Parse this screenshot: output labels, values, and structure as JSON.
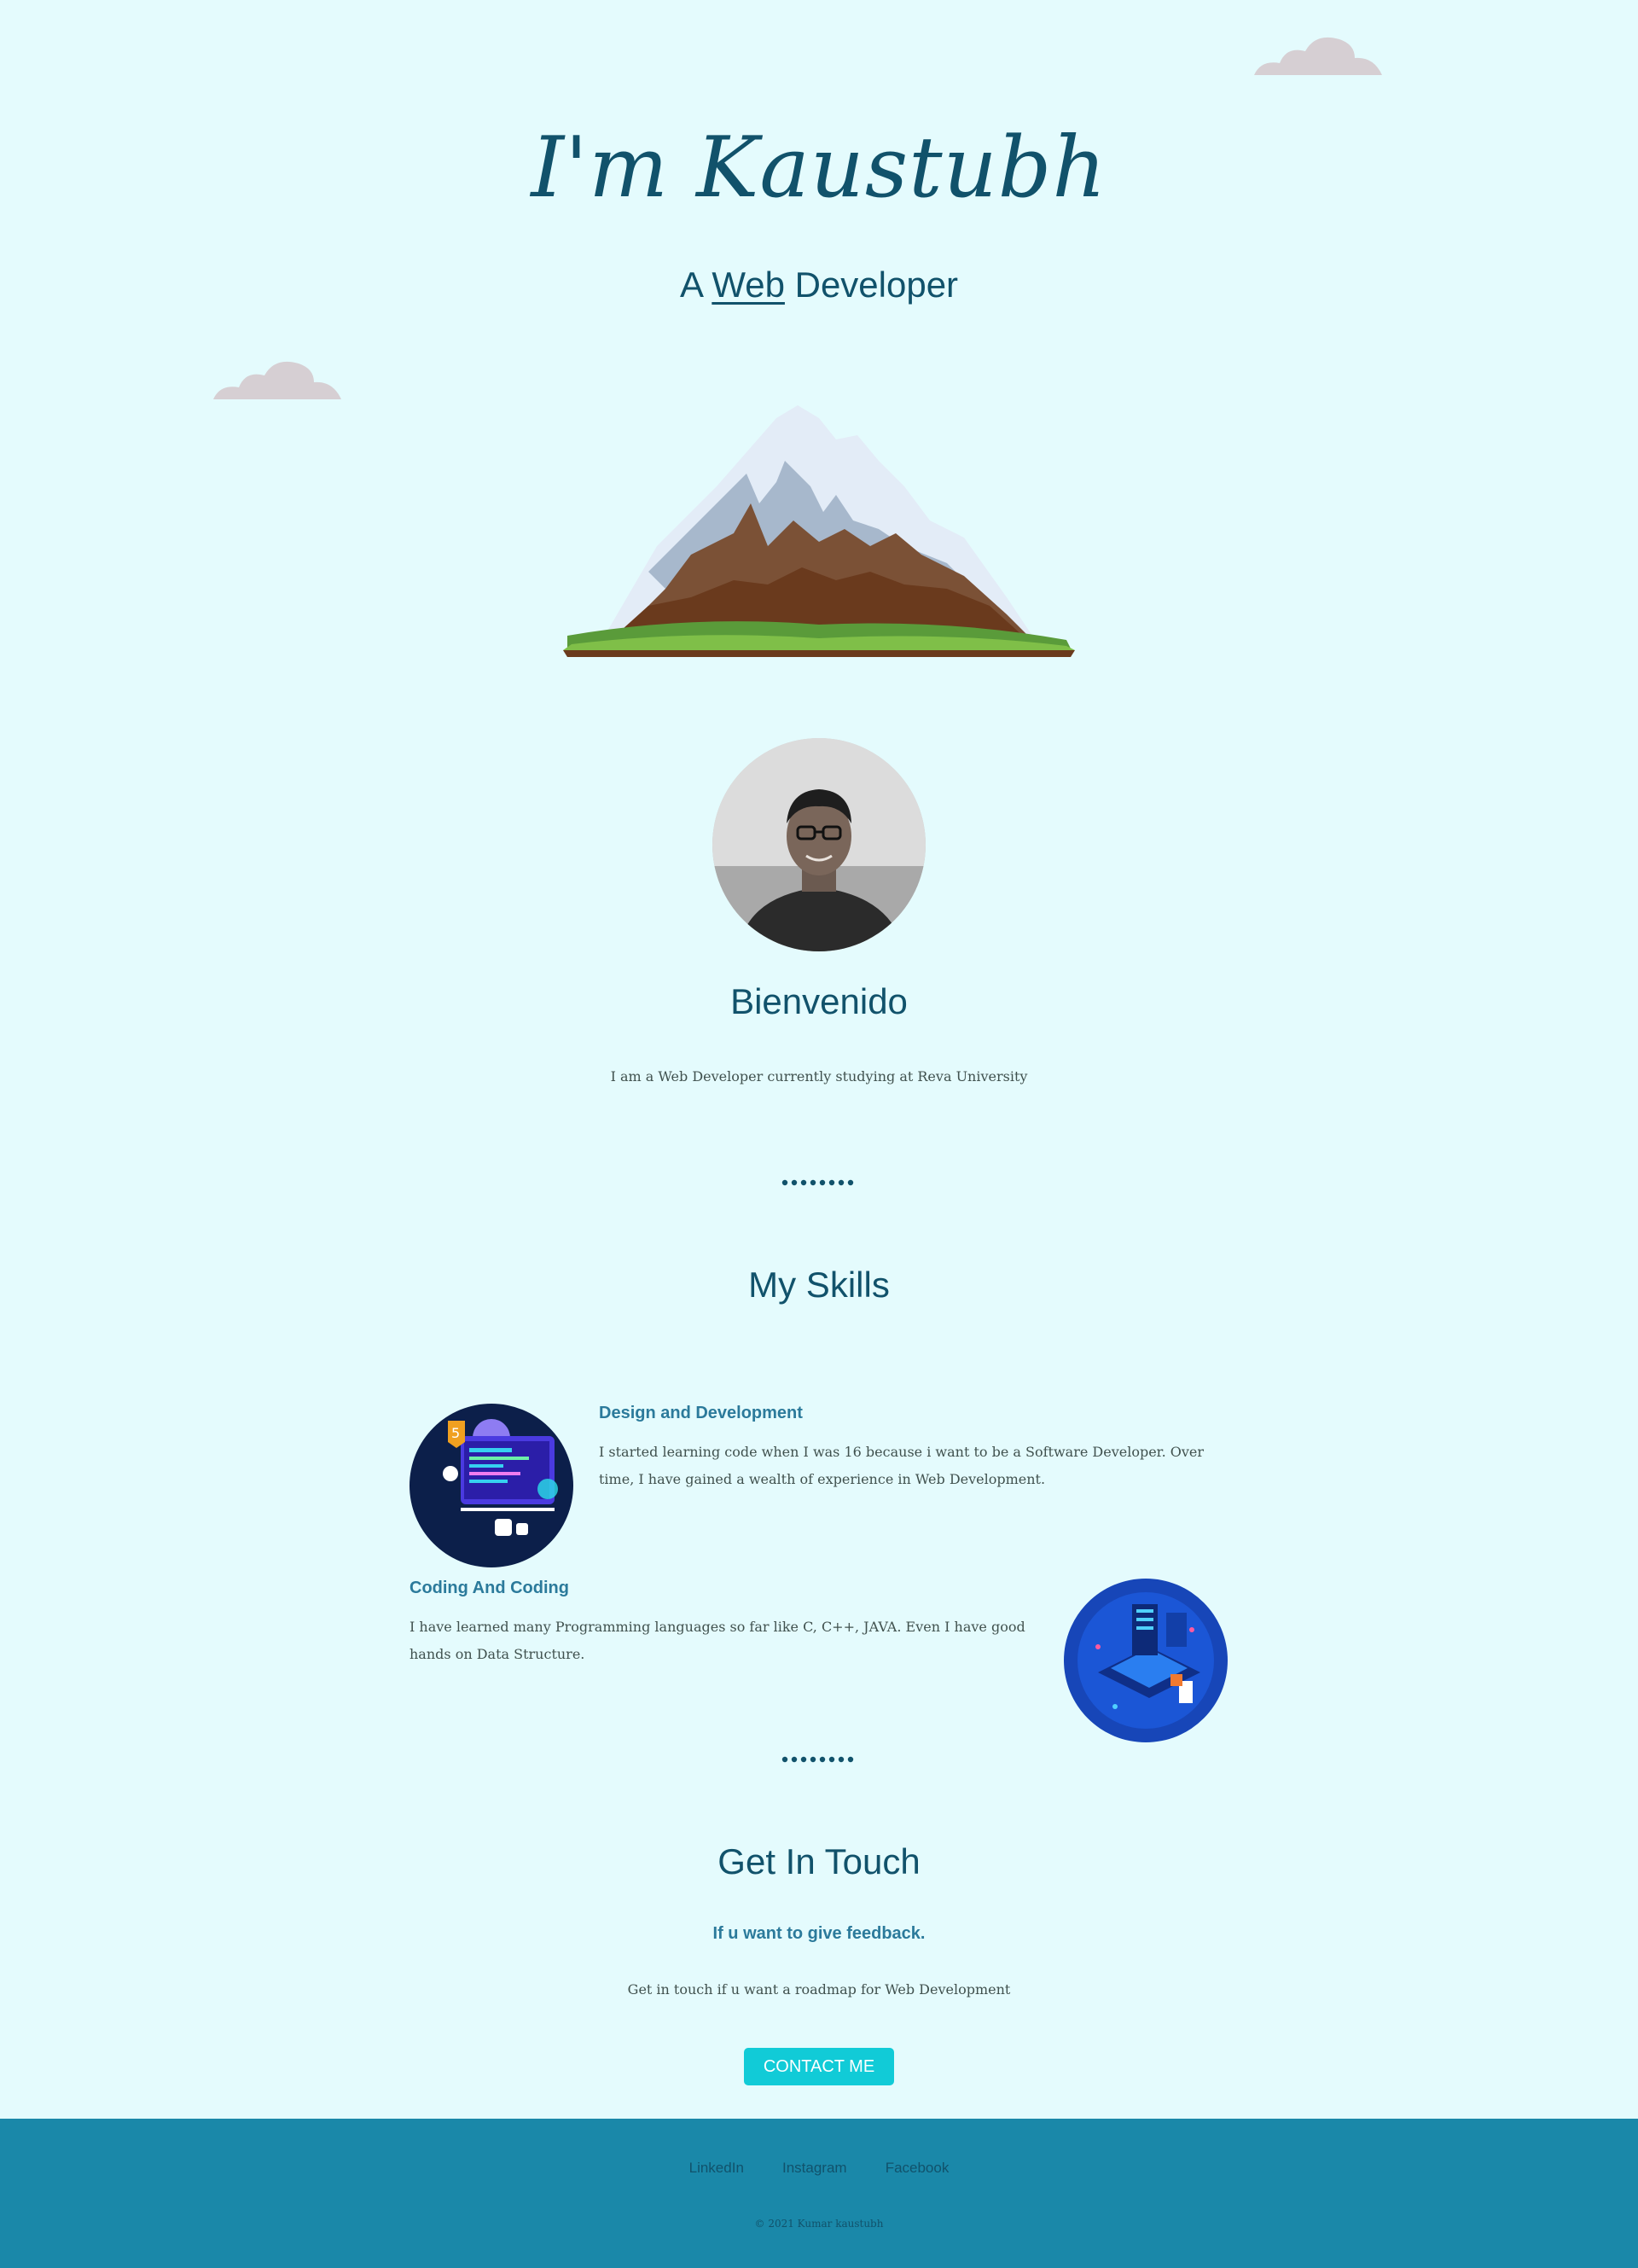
{
  "hero": {
    "title": "I'm Kaustubh",
    "subtitle_prefix": "A ",
    "subtitle_highlight": "Web",
    "subtitle_suffix": " Developer"
  },
  "profile": {
    "heading": "Bienvenido",
    "intro": "I am a Web Developer currently studying at Reva University"
  },
  "skills": {
    "heading": "My Skills",
    "items": [
      {
        "title": "Design and Development",
        "text": "I started learning code when I was 16 because i want to be a Software Developer. Over time, I have gained a wealth of experience in Web Development."
      },
      {
        "title": "Coding And Coding",
        "text": "I have learned many Programming languages so far like C, C++, JAVA. Even I have good hands on Data Structure."
      }
    ]
  },
  "contact": {
    "heading": "Get In Touch",
    "subheading": "If u want to give feedback.",
    "text": "Get in touch if u want a roadmap for Web Development",
    "button": "CONTACT ME"
  },
  "footer": {
    "links": [
      "LinkedIn",
      "Instagram",
      "Facebook"
    ],
    "copyright": "© 2021 Kumar kaustubh"
  },
  "colors": {
    "background": "#e4fbfd",
    "heading": "#11526b",
    "accent": "#11cbd7",
    "footer": "#1a88a9"
  }
}
